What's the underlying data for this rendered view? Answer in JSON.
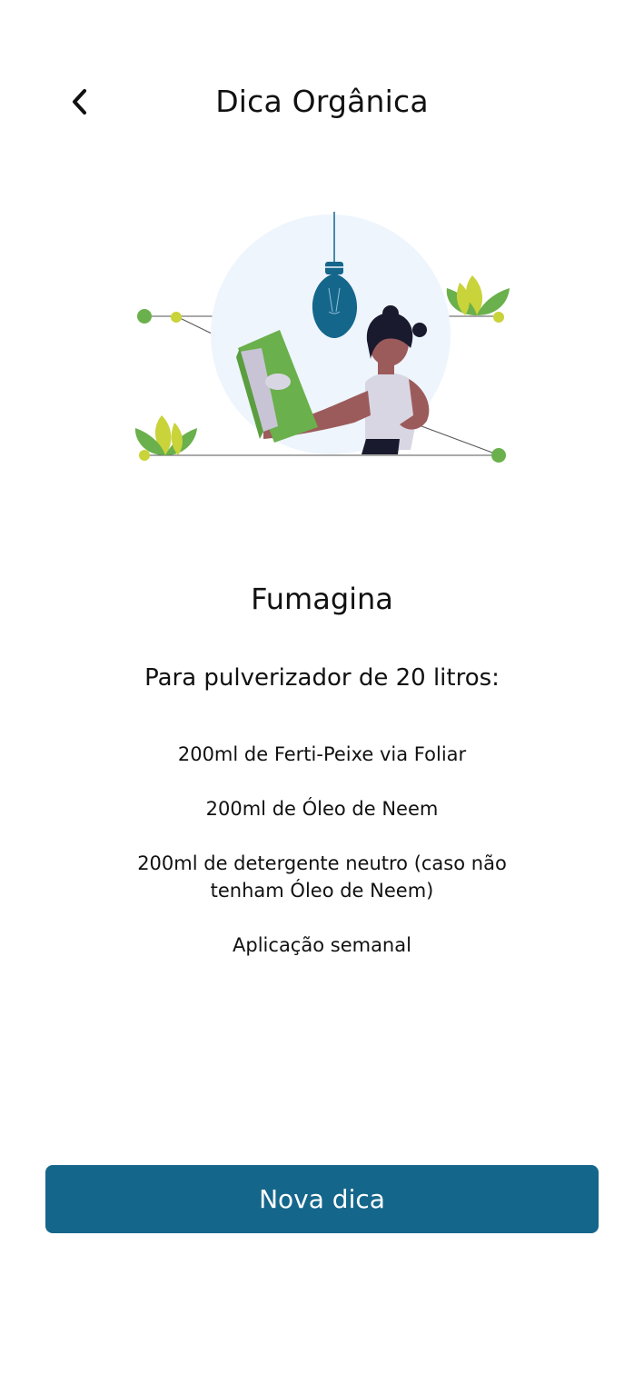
{
  "header": {
    "title": "Dica Orgânica",
    "back_icon": "chevron-left-icon"
  },
  "illustration": {
    "description_icon": "woman-reading-book-with-lightbulb-icon",
    "colors": {
      "circle": "#eef5fd",
      "bulb": "#15668b",
      "book": "#6ab04c",
      "leaf_yellow": "#c9d33a",
      "leaf_green": "#6ab04c",
      "skin": "#9c5b5b",
      "hair": "#1a1a2e"
    }
  },
  "tip": {
    "title": "Fumagina",
    "subtitle": "Para pulverizador de 20 litros:",
    "items": [
      "200ml de Ferti-Peixe via Foliar",
      "200ml de Óleo de Neem",
      "200ml de detergente neutro (caso não tenham Óleo de Neem)",
      "Aplicação semanal"
    ]
  },
  "actions": {
    "new_tip_label": "Nova dica",
    "accent_color": "#15668b"
  }
}
